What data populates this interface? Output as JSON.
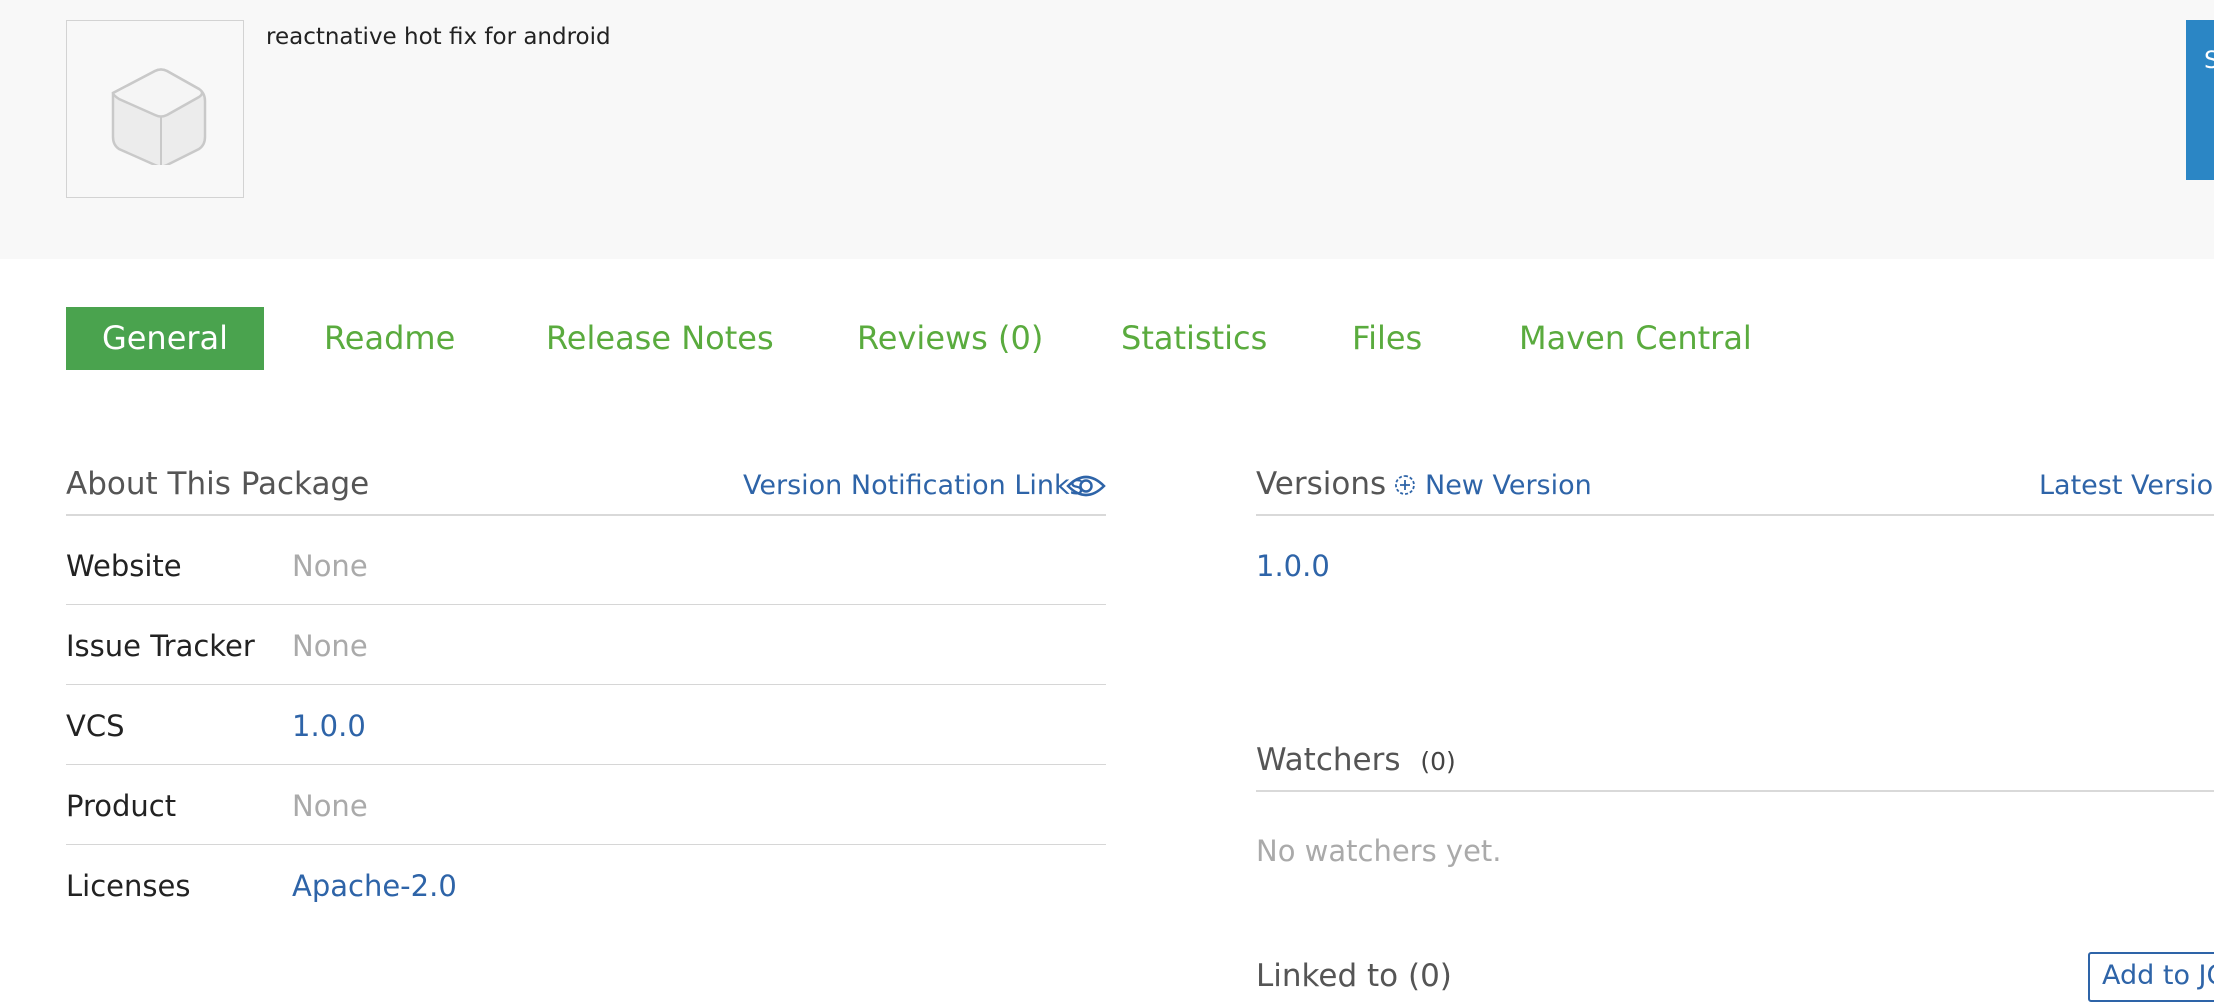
{
  "package": {
    "description": "reactnative hot fix for android",
    "corner_button_label": "S"
  },
  "tabs": [
    {
      "label": "General",
      "active": true
    },
    {
      "label": "Readme"
    },
    {
      "label": "Release Notes"
    },
    {
      "label": "Reviews (0)"
    },
    {
      "label": "Statistics"
    },
    {
      "label": "Files"
    },
    {
      "label": "Maven Central"
    }
  ],
  "about": {
    "title": "About This Package",
    "notification_link": "Version Notification Links",
    "rows": [
      {
        "label": "Website",
        "value": "None"
      },
      {
        "label": "Issue Tracker",
        "value": "None"
      },
      {
        "label": "VCS",
        "value": "1.0.0"
      },
      {
        "label": "Product",
        "value": "None"
      },
      {
        "label": "Licenses",
        "value": "Apache-2.0"
      }
    ]
  },
  "versions": {
    "title": "Versions",
    "new_version_link": "New Version",
    "latest_version_link": "Latest Version",
    "items": [
      "1.0.0"
    ]
  },
  "watchers": {
    "title": "Watchers",
    "count": "(0)",
    "empty_text": "No watchers yet."
  },
  "linked": {
    "title": "Linked to",
    "count": "(0)",
    "add_button": "Add to JC"
  },
  "colors": {
    "accent_green": "#4aa34e",
    "tab_green": "#5aab3e",
    "link_blue": "#2e64a8",
    "button_blue": "#2b86c5",
    "header_bg": "#f8f8f8"
  },
  "icons": [
    "package-placeholder-icon",
    "eye-icon",
    "plus-circle-icon"
  ]
}
